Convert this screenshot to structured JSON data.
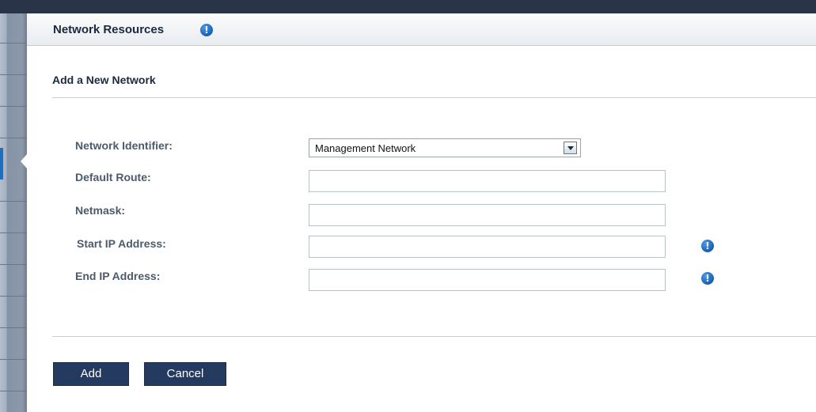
{
  "header": {
    "title": "Network Resources",
    "info_icon": "info-icon"
  },
  "form": {
    "section_title": "Add a New Network",
    "fields": {
      "network_identifier": {
        "label": "Network Identifier:",
        "value": "Management Network"
      },
      "default_route": {
        "label": "Default Route:",
        "value": ""
      },
      "netmask": {
        "label": "Netmask:",
        "value": ""
      },
      "start_ip": {
        "label": "Start IP Address:",
        "value": "",
        "icon": "info-icon"
      },
      "end_ip": {
        "label": "End IP Address:",
        "value": "",
        "icon": "info-icon"
      }
    }
  },
  "actions": {
    "add_label": "Add",
    "cancel_label": "Cancel"
  },
  "colors": {
    "top_bar": "#2a3448",
    "button_bg": "#243a5e",
    "info_icon": "#1a5fb0",
    "label_text": "#4d5a6a"
  }
}
